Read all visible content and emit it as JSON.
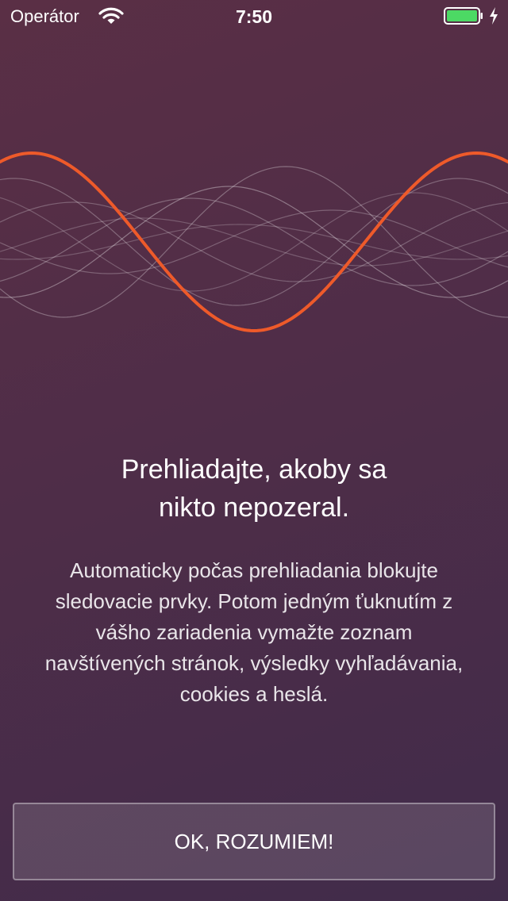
{
  "status_bar": {
    "carrier": "Operátor",
    "time": "7:50",
    "battery_level": 1.0,
    "battery_color": "#4cd964",
    "charging": true
  },
  "colors": {
    "accent_wave": "#ee5a2a",
    "background_top": "#5a2f45",
    "background_bottom": "#412c4a"
  },
  "onboarding": {
    "headline_line1": "Prehliadajte, akoby sa",
    "headline_line2": "nikto nepozeral.",
    "body_lines": [
      "Automaticky počas prehliadania blokujte",
      "sledovacie prvky. Potom jedným ťuknutím z",
      "vášho zariadenia vymažte zoznam",
      "navštívených stránok, výsledky vyhľadávania,",
      "cookies a heslá."
    ],
    "ok_button_label": "OK, ROZUMIEM!"
  }
}
